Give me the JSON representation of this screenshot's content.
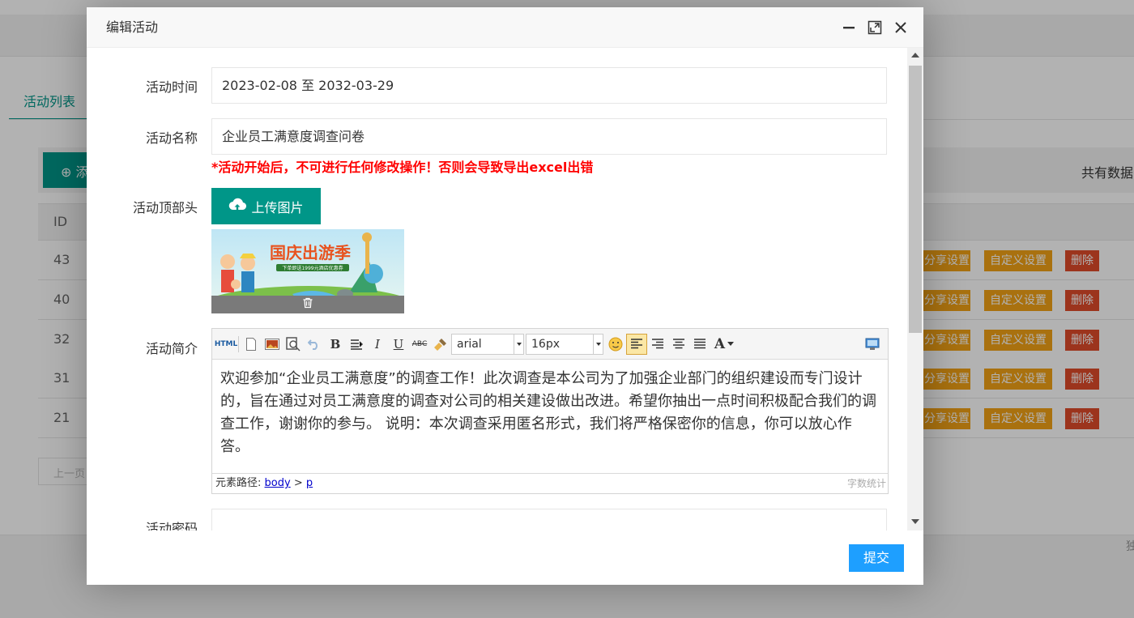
{
  "background": {
    "tab_label": "活动列表",
    "add_button_label": "⊕ 添",
    "total_label": "共有数据",
    "id_header": "ID",
    "rows": [
      {
        "id": "43",
        "share": "分享设置",
        "custom": "自定义设置",
        "delete": "删除"
      },
      {
        "id": "40",
        "share": "分享设置",
        "custom": "自定义设置",
        "delete": "删除"
      },
      {
        "id": "32",
        "share": "分享设置",
        "custom": "自定义设置",
        "delete": "删除"
      },
      {
        "id": "31",
        "share": "分享设置",
        "custom": "自定义设置",
        "delete": "删除"
      },
      {
        "id": "21",
        "share": "分享设置",
        "custom": "自定义设置",
        "delete": "删除"
      }
    ],
    "pager_prev": "上一页",
    "footer_text": "独"
  },
  "modal": {
    "title": "编辑活动",
    "fields": {
      "time_label": "活动时间",
      "time_value": "2023-02-08 至 2032-03-29",
      "name_label": "活动名称",
      "name_value": "企业员工满意度调查问卷",
      "warning": "*活动开始后，不可进行任何修改操作！否则会导致导出excel出错",
      "header_label": "活动顶部头",
      "upload_label": "上传图片",
      "banner_title": "国庆出游季",
      "banner_subtitle": "下单即送1999元酒店优惠券",
      "intro_label": "活动简介",
      "password_label": "活动密码",
      "password_value": ""
    },
    "editor": {
      "html_label": "HTML",
      "font_family": "arial",
      "font_size": "16px",
      "content": "欢迎参加“企业员工满意度”的调查工作！此次调查是本公司为了加强企业部门的组织建设而专门设计的，旨在通过对员工满意度的调查对公司的相关建设做出改进。希望你抽出一点时间积极配合我们的调查工作，谢谢你的参与。 说明：本次调查采用匿名形式，我们将严格保密你的信息，你可以放心作答。",
      "path_label": "元素路径:",
      "path_body": "body",
      "path_sep": ">",
      "path_p": "p",
      "word_count": "字数统计"
    },
    "submit_label": "提交"
  },
  "colors": {
    "primary": "#009688",
    "accent": "#1e9fff",
    "warning": "#ff0000",
    "orange": "#f2a216",
    "danger": "#e04b2a"
  }
}
